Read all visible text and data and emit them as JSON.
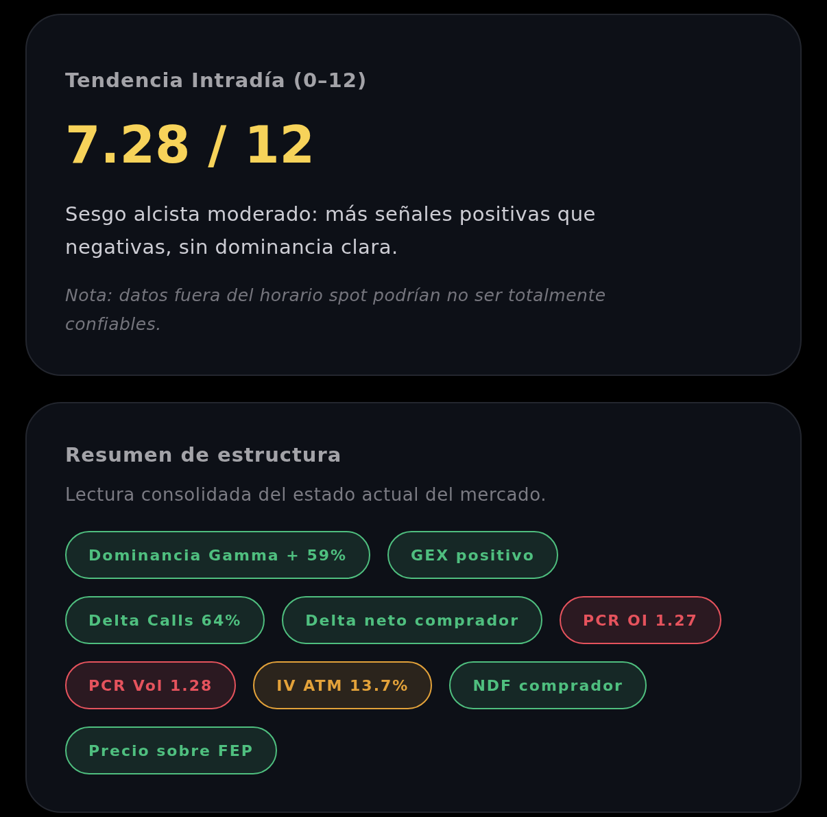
{
  "trend_card": {
    "title": "Tendencia Intradía (0–12)",
    "score": "7.28 / 12",
    "description": "Sesgo alcista moderado: más señales positivas que negativas, sin dominancia clara.",
    "note": "Nota: datos fuera del horario spot podrían no ser totalmente confiables."
  },
  "structure_card": {
    "title": "Resumen de estructura",
    "subtitle": "Lectura consolidada del estado actual del mercado.",
    "tags": [
      {
        "label": "Dominancia Gamma + 59%",
        "color": "#4fbf7f"
      },
      {
        "label": "GEX positivo",
        "color": "#4fbf7f"
      },
      {
        "label": "Delta Calls 64%",
        "color": "#4fbf7f"
      },
      {
        "label": "Delta neto comprador",
        "color": "#4fbf7f"
      },
      {
        "label": "PCR OI 1.27",
        "color": "#e5535d"
      },
      {
        "label": "PCR Vol 1.28",
        "color": "#e5535d"
      },
      {
        "label": "IV ATM 13.7%",
        "color": "#e3a23a"
      },
      {
        "label": "NDF comprador",
        "color": "#4fbf7f"
      },
      {
        "label": "Precio sobre FEP",
        "color": "#4fbf7f"
      }
    ]
  }
}
